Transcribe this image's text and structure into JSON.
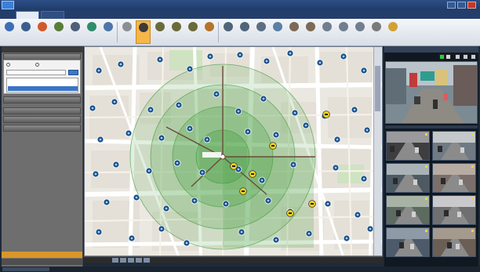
{
  "window": {
    "title": "",
    "logo_text": ""
  },
  "tabs": [
    {
      "label": "",
      "active": true
    },
    {
      "label": "",
      "active": false
    }
  ],
  "toolbar": {
    "buttons": [
      {
        "label": "",
        "icon": "link-icon"
      },
      {
        "label": "",
        "icon": "pin-icon"
      },
      {
        "label": "",
        "icon": "camera-icon"
      },
      {
        "label": "",
        "icon": "settings-icon"
      },
      {
        "label": "",
        "icon": "list-icon"
      },
      {
        "label": "",
        "icon": "refresh-icon"
      },
      {
        "label": "",
        "icon": "home-icon"
      },
      {
        "label": "",
        "icon": "circle-icon"
      },
      {
        "label": "",
        "icon": "radius-icon",
        "active": true
      },
      {
        "label": "",
        "icon": "target-icon"
      },
      {
        "label": "",
        "icon": "target-icon"
      },
      {
        "label": "",
        "icon": "target-icon"
      },
      {
        "label": "",
        "icon": "person-icon"
      },
      {
        "label": "",
        "icon": "print-icon"
      },
      {
        "label": "",
        "icon": "copy-icon"
      },
      {
        "label": "",
        "icon": "layers-icon"
      },
      {
        "label": "",
        "icon": "chart-icon"
      },
      {
        "label": "",
        "icon": "pen-icon"
      },
      {
        "label": "",
        "icon": "pen-icon"
      },
      {
        "label": "",
        "icon": "ruler-icon"
      },
      {
        "label": "",
        "icon": "ruler-icon"
      },
      {
        "label": "",
        "icon": "area-icon"
      },
      {
        "label": "",
        "icon": "eraser-icon"
      },
      {
        "label": "",
        "icon": "antenna-icon"
      }
    ]
  },
  "left_panel": {
    "header": "",
    "search_section": {
      "title": "",
      "radio_a": "",
      "radio_b": "",
      "input_value": "",
      "button": "",
      "results": [
        "",
        ""
      ]
    },
    "sections": [
      {
        "title": ""
      },
      {
        "title": ""
      },
      {
        "title": ""
      },
      {
        "title": ""
      }
    ],
    "bottom_active": "",
    "bottom_inactive": ""
  },
  "map": {
    "center_label": "",
    "search_rings": 4,
    "status_text": "",
    "colors": {
      "road_major": "#ffffff",
      "road_minor": "#f7f3ea",
      "block": "#e4e0d7",
      "park": "#cfe3c2",
      "ring": "#3f9a3a",
      "camera_marker": "#1a4f86",
      "event_marker": "#f0d21e",
      "radial_line": "#6b4a3a"
    }
  },
  "camera_panel": {
    "header": "",
    "main_view_caption": "",
    "tiles": [
      {
        "caption": ""
      },
      {
        "caption": ""
      },
      {
        "caption": ""
      },
      {
        "caption": ""
      },
      {
        "caption": ""
      },
      {
        "caption": ""
      },
      {
        "caption": ""
      },
      {
        "caption": ""
      }
    ]
  },
  "status": {
    "left_text": ""
  }
}
